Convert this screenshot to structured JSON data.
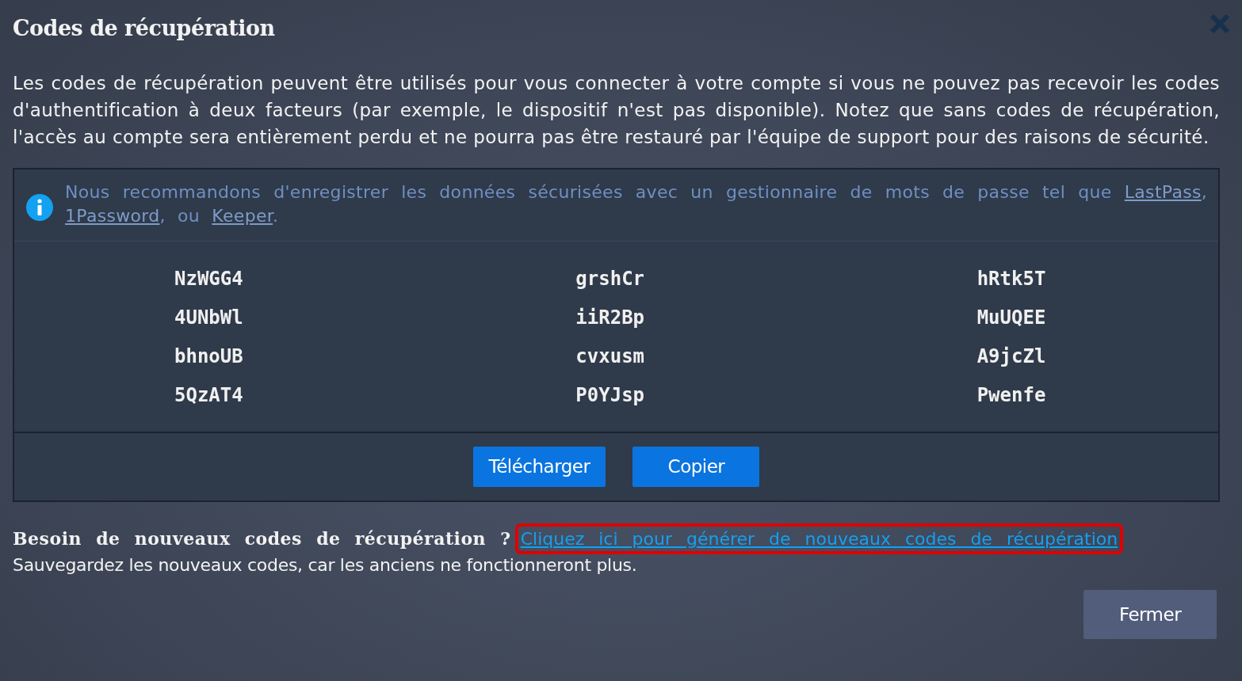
{
  "dialog": {
    "title": "Codes de récupération",
    "intro": "Les codes de récupération peuvent être utilisés pour vous connecter à votre compte si vous ne pouvez pas recevoir les codes d'authentification à deux facteurs (par exemple, le dispositif n'est pas disponible). Notez que sans codes de récupération, l'accès au compte sera entièrement perdu et ne pourra pas être restauré par l'équipe de support pour des raisons de sécurité.",
    "info": [
      {
        "kind": "text",
        "text": "Nous recommandons d'enregistrer les données sécurisées avec un gestionnaire de mots de passe tel que "
      },
      {
        "kind": "link",
        "text": "LastPass"
      },
      {
        "kind": "text",
        "text": ", "
      },
      {
        "kind": "link",
        "text": "1Password"
      },
      {
        "kind": "text",
        "text": ", ou "
      },
      {
        "kind": "link",
        "text": "Keeper"
      },
      {
        "kind": "text",
        "text": "."
      }
    ],
    "codes": [
      [
        "NzWGG4",
        "grshCr",
        "hRtk5T"
      ],
      [
        "4UNbWl",
        "iiR2Bp",
        "MuUQEE"
      ],
      [
        "bhnoUB",
        "cvxusm",
        "A9jcZl"
      ],
      [
        "5QzAT4",
        "P0YJsp",
        "Pwenfe"
      ]
    ],
    "buttons": [
      "Télécharger",
      "Copier"
    ],
    "regenerate": {
      "question": "Besoin de nouveaux codes de récupération ?",
      "link": "Cliquez ici pour générer de nouveaux codes de récupération",
      "highlighted": true
    },
    "note": "Sauvegardez les nouveaux codes, car les anciens ne fonctionneront plus.",
    "close_button": "Fermer"
  }
}
